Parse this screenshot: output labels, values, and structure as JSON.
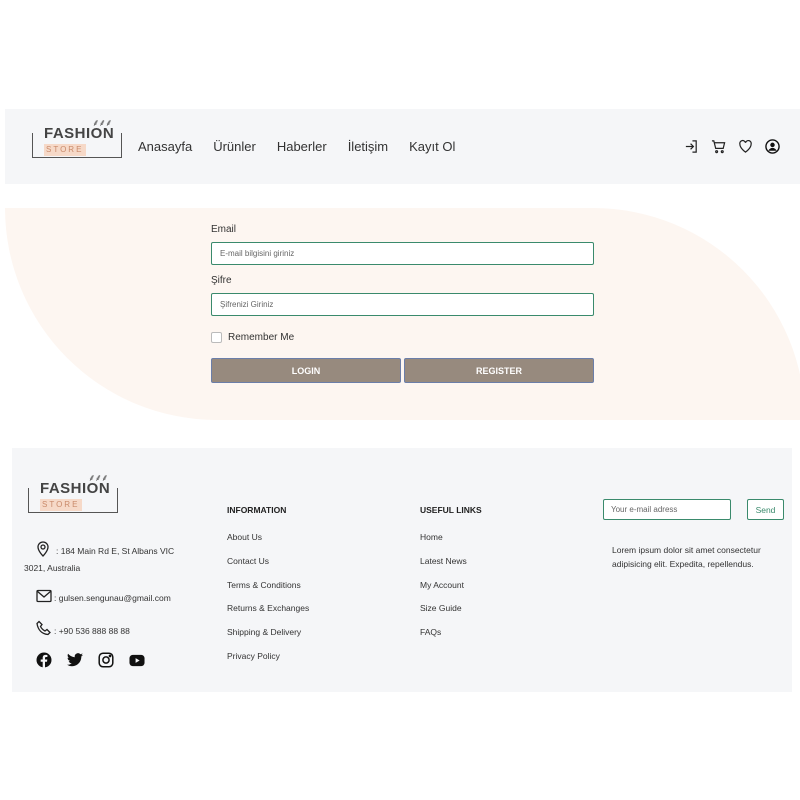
{
  "brand": {
    "logo_main": "FASHION",
    "logo_sub": "STORE"
  },
  "nav": {
    "links": [
      "Anasayfa",
      "Ürünler",
      "Haberler",
      "İletişim",
      "Kayıt Ol"
    ],
    "icons": [
      "login-icon",
      "cart-icon",
      "heart-icon",
      "user-icon"
    ]
  },
  "login": {
    "email_label": "Email",
    "email_placeholder": "E-mail bilgisini giriniz",
    "password_label": "Şifre",
    "password_placeholder": "Şifrenizi Giriniz",
    "remember_label": "Remember Me",
    "login_button": "LOGIN",
    "register_button": "REGISTER"
  },
  "footer": {
    "address": ": 184 Main Rd E, St Albans VIC",
    "address_line2": "3021, Australia",
    "email": ": gulsen.sengunau@gmail.com",
    "phone": ": +90 536 888 88 88",
    "information": {
      "title": "INFORMATION",
      "items": [
        "About Us",
        "Contact Us",
        "Terms & Conditions",
        "Returns & Exchanges",
        "Shipping & Delivery",
        "Privacy Policy"
      ]
    },
    "useful_links": {
      "title": "USEFUL LINKS",
      "items": [
        "Home",
        "Latest News",
        "My Account",
        "Size Guide",
        "FAQs"
      ]
    },
    "newsletter": {
      "placeholder": "Your e-mail adress",
      "button": "Send",
      "text": "Lorem ipsum dolor sit amet consectetur adipisicing elit. Expedita, repellendus."
    },
    "social": [
      "facebook-icon",
      "twitter-icon",
      "instagram-icon",
      "youtube-icon"
    ]
  },
  "colors": {
    "accent_green": "#3a8a6c",
    "button_brown": "#978a7e",
    "login_bg": "#fdf6f1",
    "panel_bg": "#f5f6f8"
  }
}
